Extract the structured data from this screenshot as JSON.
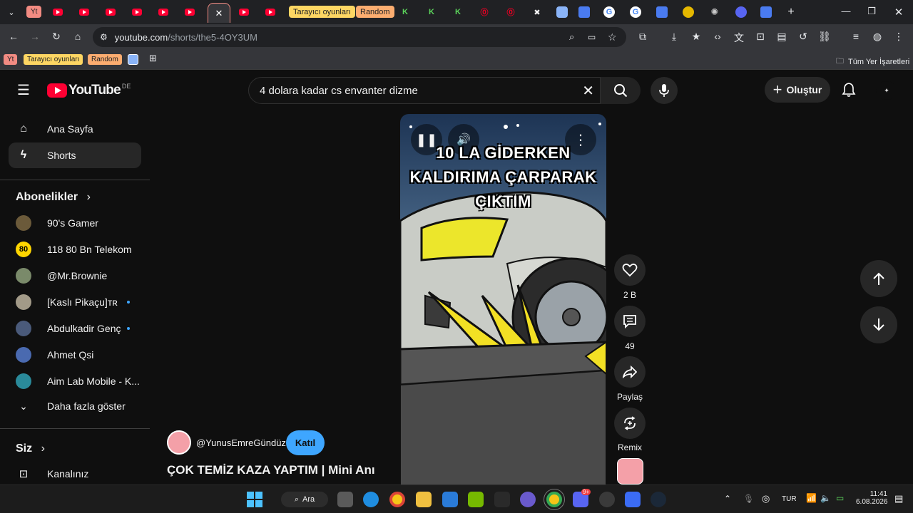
{
  "browser": {
    "tab_groups": {
      "yt": "Yt",
      "games": "Tarayıcı oyunları",
      "random": "Random"
    },
    "url_domain": "youtube.com",
    "url_path": "/shorts/the5-4OY3UM",
    "bookmarks": {
      "yt": "Yt",
      "games": "Tarayıcı oyunları",
      "random": "Random",
      "all": "Tüm Yer İşaretleri"
    }
  },
  "masthead": {
    "logo_text": "YouTube",
    "region": "DE",
    "search_value": "4 dolara kadar cs envanter dizme",
    "create_label": "Oluştur"
  },
  "sidebar": {
    "home": "Ana Sayfa",
    "shorts": "Shorts",
    "subscriptions_header": "Abonelikler",
    "subscriptions": [
      {
        "name": "90's Gamer",
        "color": "#6b5a3a"
      },
      {
        "name": "118 80 Bn Telekom",
        "color": "#ffd600",
        "badge": "80"
      },
      {
        "name": "@Mr.Brownie",
        "color": "#7a8a6a"
      },
      {
        "name": "[Kaslı Pikaçu]ᴛʀ",
        "color": "#a29a88"
      },
      {
        "name": "Abdulkadir Genç",
        "color": "#4a5a7a"
      },
      {
        "name": "Ahmet Qsi",
        "color": "#4a6ab0"
      },
      {
        "name": "Aim Lab Mobile - K...",
        "color": "#2a8a9a"
      }
    ],
    "show_more": "Daha fazla göster",
    "you_header": "Siz",
    "your_channel": "Kanalınız"
  },
  "short": {
    "caption_lines": [
      "10 LA GİDERKEN",
      "KALDIRIMA ÇARPARAK",
      "ÇIKTIM"
    ],
    "channel": "@YunusEmreGündüz",
    "join_label": "Katıl",
    "title": "ÇOK TEMİZ KAZA YAPTIM | Mini Anı"
  },
  "actions": {
    "likes": "2 B",
    "comments": "49",
    "share": "Paylaş",
    "remix": "Remix"
  },
  "taskbar": {
    "search_label": "Ara",
    "lang": "TUR",
    "time": "11:41",
    "date": "6.08.2026",
    "discord_badge": "9+"
  }
}
